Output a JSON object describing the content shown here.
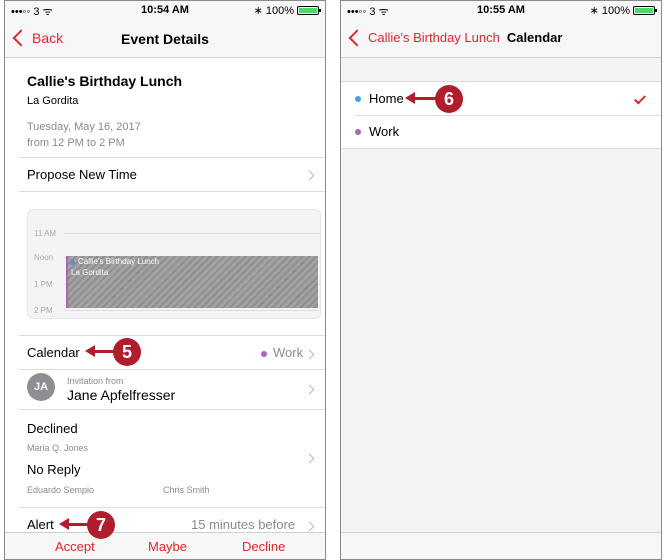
{
  "left_screen": {
    "status": {
      "carrier": "•••◦◦ 3 ᯤ",
      "time": "10:54 AM",
      "bluetooth": "∗",
      "battery": "100%"
    },
    "nav": {
      "back": "Back",
      "title": "Event Details"
    },
    "event": {
      "title": "Callie's Birthday Lunch",
      "location": "La Gordita",
      "date": "Tuesday, May 16, 2017",
      "time": "from 12 PM to 2 PM"
    },
    "propose_new_time": "Propose New Time",
    "day_view": {
      "hours": [
        "11 AM",
        "Noon",
        "1 PM",
        "2 PM"
      ],
      "event_name": "Callie's Birthday Lunch",
      "event_location": "La Gordita"
    },
    "calendar_row": {
      "label": "Calendar",
      "value": "Work"
    },
    "invitation": {
      "avatar_initials": "JA",
      "caption": "Invitation from",
      "name": "Jane Apfelfresser"
    },
    "declined": {
      "label": "Declined",
      "person": "Maria Q. Jones"
    },
    "no_reply": {
      "label": "No Reply",
      "people": [
        "Eduardo Sempio",
        "Chris Smith"
      ]
    },
    "alert": {
      "label": "Alert",
      "value": "15 minutes before"
    },
    "toolbar": {
      "accept": "Accept",
      "maybe": "Maybe",
      "decline": "Decline"
    },
    "callouts": {
      "calendar": "5",
      "alert": "7"
    }
  },
  "right_screen": {
    "status": {
      "carrier": "•••◦◦ 3 ᯤ",
      "time": "10:55 AM",
      "bluetooth": "∗",
      "battery": "100%"
    },
    "nav": {
      "back": "Callie's Birthday Lunch",
      "title": "Calendar"
    },
    "calendars": [
      {
        "name": "Home",
        "selected": true,
        "color": "#4a9fdc"
      },
      {
        "name": "Work",
        "selected": false,
        "color": "#b061c0"
      }
    ],
    "callouts": {
      "home": "6"
    }
  },
  "colors": {
    "accent": "#e0262d",
    "callout": "#b01e2e",
    "work": "#b061c0",
    "home": "#4a9fdc"
  }
}
